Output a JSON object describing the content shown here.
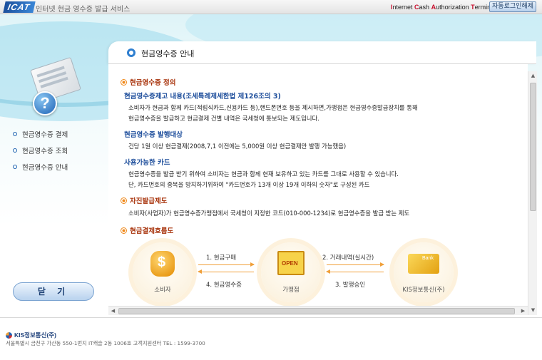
{
  "header": {
    "logo_text": "ICAT",
    "service_title": "인터넷 현금 영수증 발급 서비스",
    "terminal_parts": [
      {
        "hl": "I",
        "rest": "nternet "
      },
      {
        "hl": "C",
        "rest": "ash "
      },
      {
        "hl": "A",
        "rest": "uthorization "
      },
      {
        "hl": "T",
        "rest": "erminal"
      }
    ],
    "logout_label": "자동로그인해제"
  },
  "sidebar": {
    "menu": [
      {
        "label": "현금영수증 결제"
      },
      {
        "label": "현금영수증 조회"
      },
      {
        "label": "현금영수증 안내"
      }
    ],
    "close_label": "닫 기",
    "hero_icon_glyph": "?"
  },
  "panel": {
    "title": "현금영수증 안내"
  },
  "content": {
    "definition_title": "현금영수증 정의",
    "issue_content_title": "현금영수증제고 내용(조세특례제세한법 제126조의 3)",
    "issue_content_lines": [
      "소비자가 현금과 함께 카드(적립식카드,신용카드 등),핸드폰번호 등을 제시하면,가맹점은 현금영수증발급장치를 통해",
      "현금영수증을 발급하고 현금결제 건별 내역은 국세청에 통보되는 제도입니다."
    ],
    "target_title": "현금영수증 발행대상",
    "target_line": "건당 1원 이상 현금결제(2008,7,1 이전에는 5,000원 이상 현금결제만 발행 가능했음)",
    "cards_title": "사용가능한 카드",
    "cards_lines": [
      "현금영수증을 발급 받기 위하여 소비자는 현금과 함께 현재 보유하고 있는 카드를 그대로 사용할 수 있습니다.",
      "단, 카드번호의 중복을 방지하기위하여 \"카드번호가 13개 이상 19개 이하의 숫자\"로 구성된 카드"
    ],
    "self_issue_title": "자진발급제도",
    "self_issue_line": "소비자(사업자)가 현금영수증가맹점에서 국세청이 지정한 코드(010-000-1234)로 현금영수증을 발급 받는 제도",
    "flow_title": "현금결제흐름도"
  },
  "flow": {
    "nodes": [
      {
        "label": "소비자"
      },
      {
        "label": "가맹점"
      },
      {
        "label": "KIS정보통신(주)"
      }
    ],
    "steps": [
      {
        "label": "1. 현금구매"
      },
      {
        "label": "2. 거래내역(실시간)"
      },
      {
        "label": "3. 발행승인"
      },
      {
        "label": "4. 현금영수증"
      }
    ],
    "open_sign_text": "OPEN",
    "bank_card_text": "Bank"
  },
  "footer": {
    "company": "KIS정보통신(주)",
    "address": "서울특별시 금천구 가산동 550-1번지 IT캐슬 2동 1006호 고객지원센터  TEL : 1599-3700"
  },
  "colors": {
    "section_accent": "#a8330b",
    "sub_heading": "#1f4f9c",
    "bullet_orange": "#f08a1c",
    "link_blue": "#1e62b0"
  }
}
